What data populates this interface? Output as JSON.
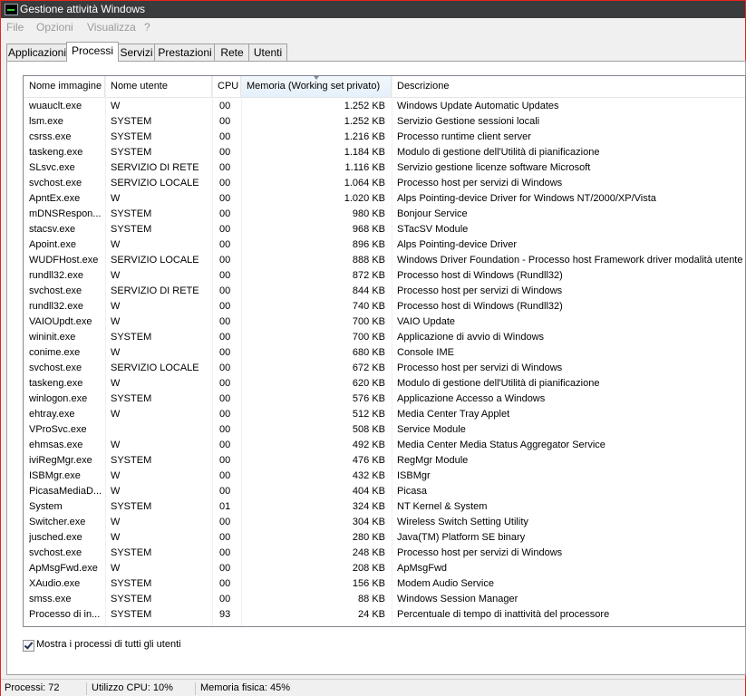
{
  "window": {
    "title": "Gestione attività Windows",
    "accent": "#e0261e"
  },
  "menu": [
    "File",
    "Opzioni",
    "Visualizza",
    "?"
  ],
  "tabs": [
    "Applicazioni",
    "Processi",
    "Servizi",
    "Prestazioni",
    "Rete",
    "Utenti"
  ],
  "active_tab": "Processi",
  "columns": [
    "Nome immagine",
    "Nome utente",
    "CPU",
    "Memoria (Working set privato)",
    "Descrizione"
  ],
  "sorted_column": "Memoria (Working set privato)",
  "processes": [
    [
      "wuauclt.exe",
      "W",
      "00",
      "1.252 KB",
      "Windows Update Automatic Updates"
    ],
    [
      "lsm.exe",
      "SYSTEM",
      "00",
      "1.252 KB",
      "Servizio Gestione sessioni locali"
    ],
    [
      "csrss.exe",
      "SYSTEM",
      "00",
      "1.216 KB",
      "Processo runtime client server"
    ],
    [
      "taskeng.exe",
      "SYSTEM",
      "00",
      "1.184 KB",
      "Modulo di gestione dell'Utilità di pianificazione"
    ],
    [
      "SLsvc.exe",
      "SERVIZIO DI RETE",
      "00",
      "1.116 KB",
      "Servizio gestione licenze software Microsoft"
    ],
    [
      "svchost.exe",
      "SERVIZIO LOCALE",
      "00",
      "1.064 KB",
      "Processo host per servizi di Windows"
    ],
    [
      "ApntEx.exe",
      "W",
      "00",
      "1.020 KB",
      "Alps Pointing-device Driver for Windows NT/2000/XP/Vista"
    ],
    [
      "mDNSRespon...",
      "SYSTEM",
      "00",
      "980 KB",
      "Bonjour Service"
    ],
    [
      "stacsv.exe",
      "SYSTEM",
      "00",
      "968 KB",
      "STacSV Module"
    ],
    [
      "Apoint.exe",
      "W",
      "00",
      "896 KB",
      "Alps Pointing-device Driver"
    ],
    [
      "WUDFHost.exe",
      "SERVIZIO LOCALE",
      "00",
      "888 KB",
      "Windows Driver Foundation - Processo host Framework driver modalità utente"
    ],
    [
      "rundll32.exe",
      "W",
      "00",
      "872 KB",
      "Processo host di Windows (Rundll32)"
    ],
    [
      "svchost.exe",
      "SERVIZIO DI RETE",
      "00",
      "844 KB",
      "Processo host per servizi di Windows"
    ],
    [
      "rundll32.exe",
      "W",
      "00",
      "740 KB",
      "Processo host di Windows (Rundll32)"
    ],
    [
      "VAIOUpdt.exe",
      "W",
      "00",
      "700 KB",
      "VAIO Update"
    ],
    [
      "wininit.exe",
      "SYSTEM",
      "00",
      "700 KB",
      "Applicazione di avvio di Windows"
    ],
    [
      "conime.exe",
      "W",
      "00",
      "680 KB",
      "Console IME"
    ],
    [
      "svchost.exe",
      "SERVIZIO LOCALE",
      "00",
      "672 KB",
      "Processo host per servizi di Windows"
    ],
    [
      "taskeng.exe",
      "W",
      "00",
      "620 KB",
      "Modulo di gestione dell'Utilità di pianificazione"
    ],
    [
      "winlogon.exe",
      "SYSTEM",
      "00",
      "576 KB",
      "Applicazione Accesso a Windows"
    ],
    [
      "ehtray.exe",
      "W",
      "00",
      "512 KB",
      "Media Center Tray Applet"
    ],
    [
      "VProSvc.exe",
      "",
      "00",
      "508 KB",
      "Service Module"
    ],
    [
      "ehmsas.exe",
      "W",
      "00",
      "492 KB",
      "Media Center Media Status Aggregator Service"
    ],
    [
      "iviRegMgr.exe",
      "SYSTEM",
      "00",
      "476 KB",
      "RegMgr Module"
    ],
    [
      "ISBMgr.exe",
      "W",
      "00",
      "432 KB",
      "ISBMgr"
    ],
    [
      "PicasaMediaD...",
      "W",
      "00",
      "404 KB",
      "Picasa"
    ],
    [
      "System",
      "SYSTEM",
      "01",
      "324 KB",
      "NT Kernel & System"
    ],
    [
      "Switcher.exe",
      "W",
      "00",
      "304 KB",
      "Wireless Switch Setting Utility"
    ],
    [
      "jusched.exe",
      "W",
      "00",
      "280 KB",
      "Java(TM) Platform SE binary"
    ],
    [
      "svchost.exe",
      "SYSTEM",
      "00",
      "248 KB",
      "Processo host per servizi di Windows"
    ],
    [
      "ApMsgFwd.exe",
      "W",
      "00",
      "208 KB",
      "ApMsgFwd"
    ],
    [
      "XAudio.exe",
      "SYSTEM",
      "00",
      "156 KB",
      "Modem Audio Service"
    ],
    [
      "smss.exe",
      "SYSTEM",
      "00",
      "88 KB",
      "Windows Session Manager"
    ],
    [
      "Processo di in...",
      "SYSTEM",
      "93",
      "24 KB",
      "Percentuale di tempo di inattività del processore"
    ]
  ],
  "show_all_users": {
    "label": "Mostra i processi di tutti gli utenti",
    "checked": true
  },
  "status": {
    "processes": "Processi: 72",
    "cpu": "Utilizzo CPU: 10%",
    "memory": "Memoria fisica: 45%"
  }
}
